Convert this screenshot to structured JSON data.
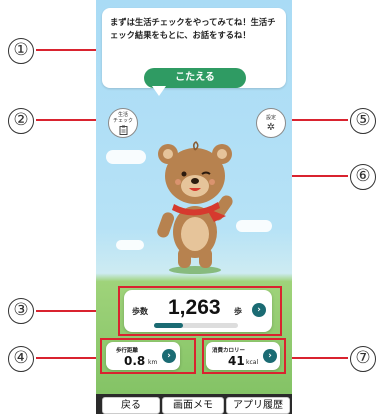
{
  "callouts": [
    "①",
    "②",
    "③",
    "④",
    "⑤",
    "⑥",
    "⑦"
  ],
  "bubble": {
    "text": "まずは生活チェックをやってみてね！生活チェック結果をもとに、お話をするね！",
    "answer_label": "こたえる"
  },
  "left_button": {
    "line1": "生活",
    "line2": "チェック",
    "icon": "clipboard-icon"
  },
  "right_button": {
    "label": "設定",
    "icon": "gear-icon"
  },
  "steps": {
    "label": "歩数",
    "value": "1,263",
    "unit": "歩",
    "progress": 0.35
  },
  "distance": {
    "label": "歩行距離",
    "value": "0.8",
    "unit": "km"
  },
  "calories": {
    "label": "消費カロリー",
    "value": "41",
    "unit": "kcal"
  },
  "bottom_bar": {
    "back": "戻る",
    "screen_memo": "画面メモ",
    "app_history": "アプリ履歴"
  },
  "colors": {
    "accent": "#2f9b63",
    "highlight": "#d9232f",
    "go": "#1b6b73"
  }
}
